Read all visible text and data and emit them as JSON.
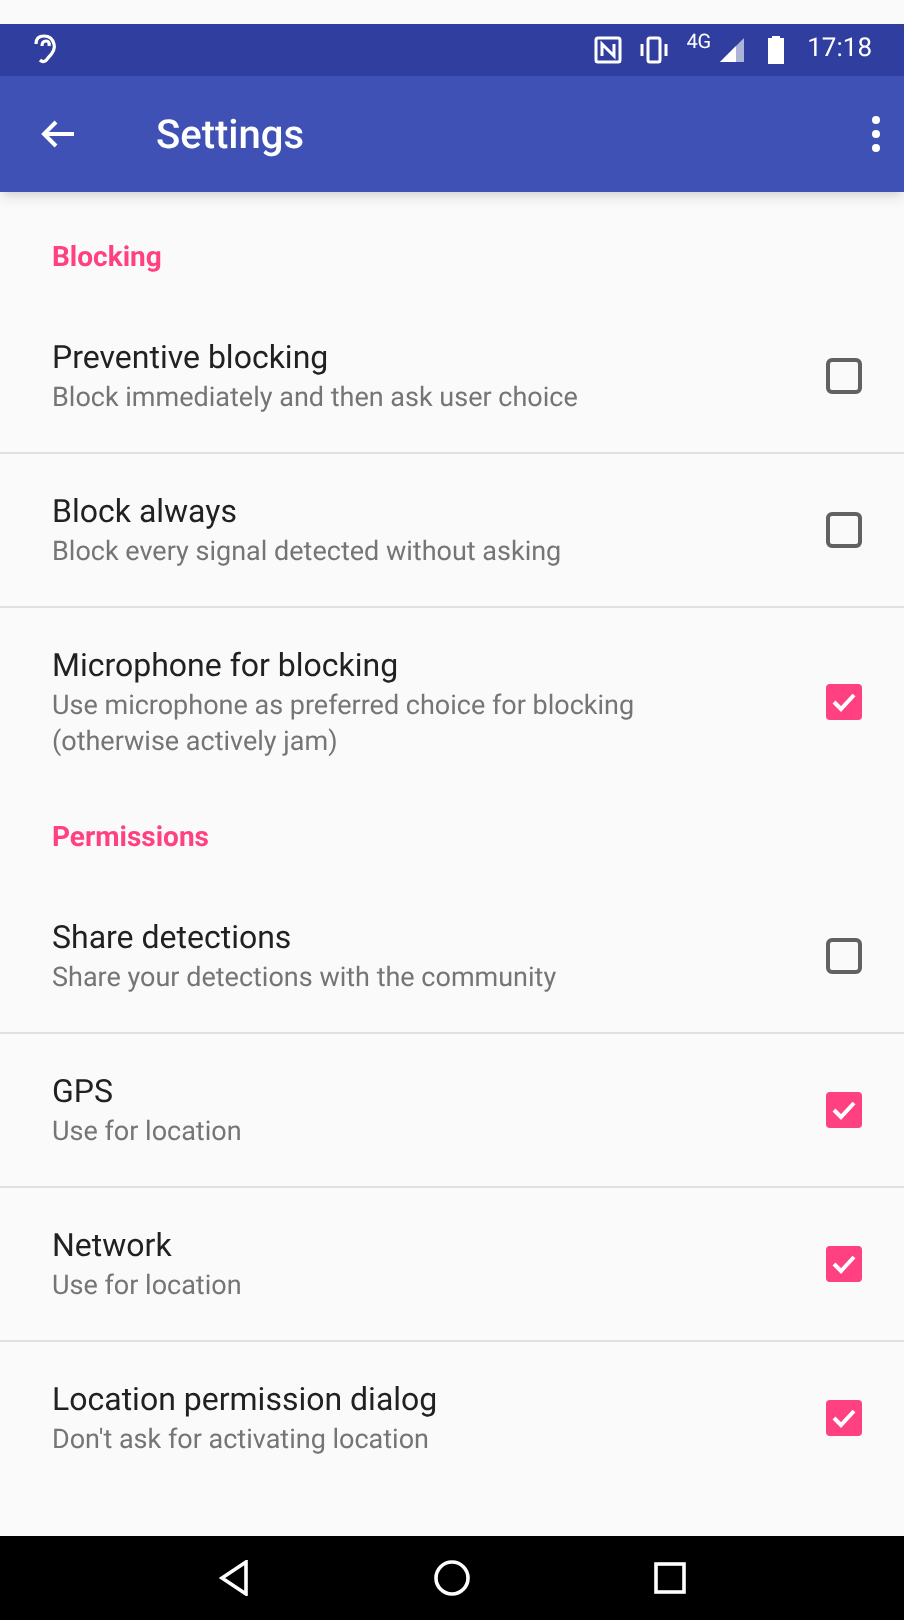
{
  "status_bar": {
    "network": "4G",
    "time": "17:18"
  },
  "app_bar": {
    "title": "Settings"
  },
  "sections": [
    {
      "title": "Blocking",
      "items": [
        {
          "title": "Preventive blocking",
          "summary": "Block immediately and then ask user choice",
          "checked": false
        },
        {
          "title": "Block always",
          "summary": "Block every signal detected without asking",
          "checked": false
        },
        {
          "title": "Microphone for blocking",
          "summary": "Use microphone as preferred choice for blocking (otherwise actively jam)",
          "checked": true
        }
      ]
    },
    {
      "title": "Permissions",
      "items": [
        {
          "title": "Share detections",
          "summary": "Share your detections with the community",
          "checked": false
        },
        {
          "title": "GPS",
          "summary": "Use for location",
          "checked": true
        },
        {
          "title": "Network",
          "summary": "Use for location",
          "checked": true
        },
        {
          "title": "Location permission dialog",
          "summary": "Don't ask for activating location",
          "checked": true
        }
      ]
    }
  ]
}
